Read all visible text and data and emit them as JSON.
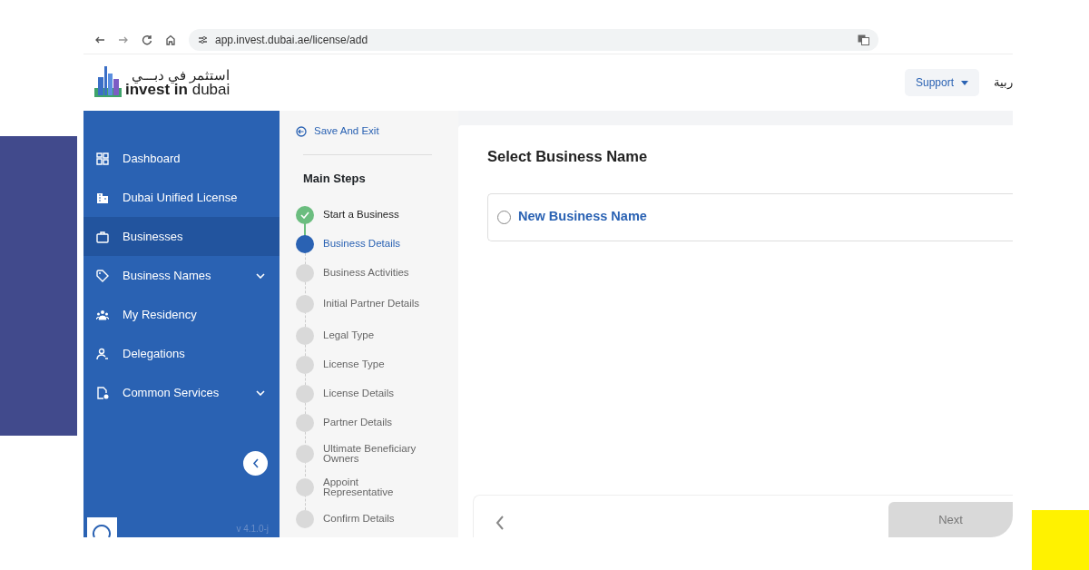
{
  "browser": {
    "url": "app.invest.dubai.ae/license/add"
  },
  "header": {
    "logo_arabic": "استثمر في دبـــي",
    "logo_text": "**invest in** dubai",
    "support_button": "Support",
    "language": "ربية"
  },
  "sidebar": {
    "items": [
      {
        "label": "Dashboard",
        "selected": false,
        "has_submenu": false
      },
      {
        "label": "Dubai Unified License",
        "selected": false,
        "has_submenu": false
      },
      {
        "label": "Businesses",
        "selected": true,
        "has_submenu": false
      },
      {
        "label": "Business Names",
        "selected": false,
        "has_submenu": true
      },
      {
        "label": "My Residency",
        "selected": false,
        "has_submenu": false
      },
      {
        "label": "Delegations",
        "selected": false,
        "has_submenu": false
      },
      {
        "label": "Common Services",
        "selected": false,
        "has_submenu": true
      }
    ],
    "version": "v 4.1.0-j"
  },
  "steps_panel": {
    "save_exit": "Save And Exit",
    "title": "Main Steps",
    "steps": [
      {
        "label": "Start a Business",
        "kind": "done"
      },
      {
        "label": "Business Details",
        "kind": "current"
      },
      {
        "label": "Business Activities",
        "kind": "pending"
      },
      {
        "label": "Initial Partner Details",
        "kind": "pending"
      },
      {
        "label": "Legal Type",
        "kind": "pending"
      },
      {
        "label": "License Type",
        "kind": "pending"
      },
      {
        "label": "License Details",
        "kind": "pending"
      },
      {
        "label": "Partner Details",
        "kind": "pending"
      },
      {
        "label": "Ultimate Beneficiary Owners",
        "kind": "pending"
      },
      {
        "label": "Appoint Representative",
        "kind": "pending"
      },
      {
        "label": "Confirm Details",
        "kind": "pending"
      }
    ]
  },
  "content": {
    "title": "Select Business Name",
    "options": [
      {
        "label": "New Business Name",
        "selected": false
      }
    ],
    "next_button": "Next",
    "next_disabled": true
  }
}
